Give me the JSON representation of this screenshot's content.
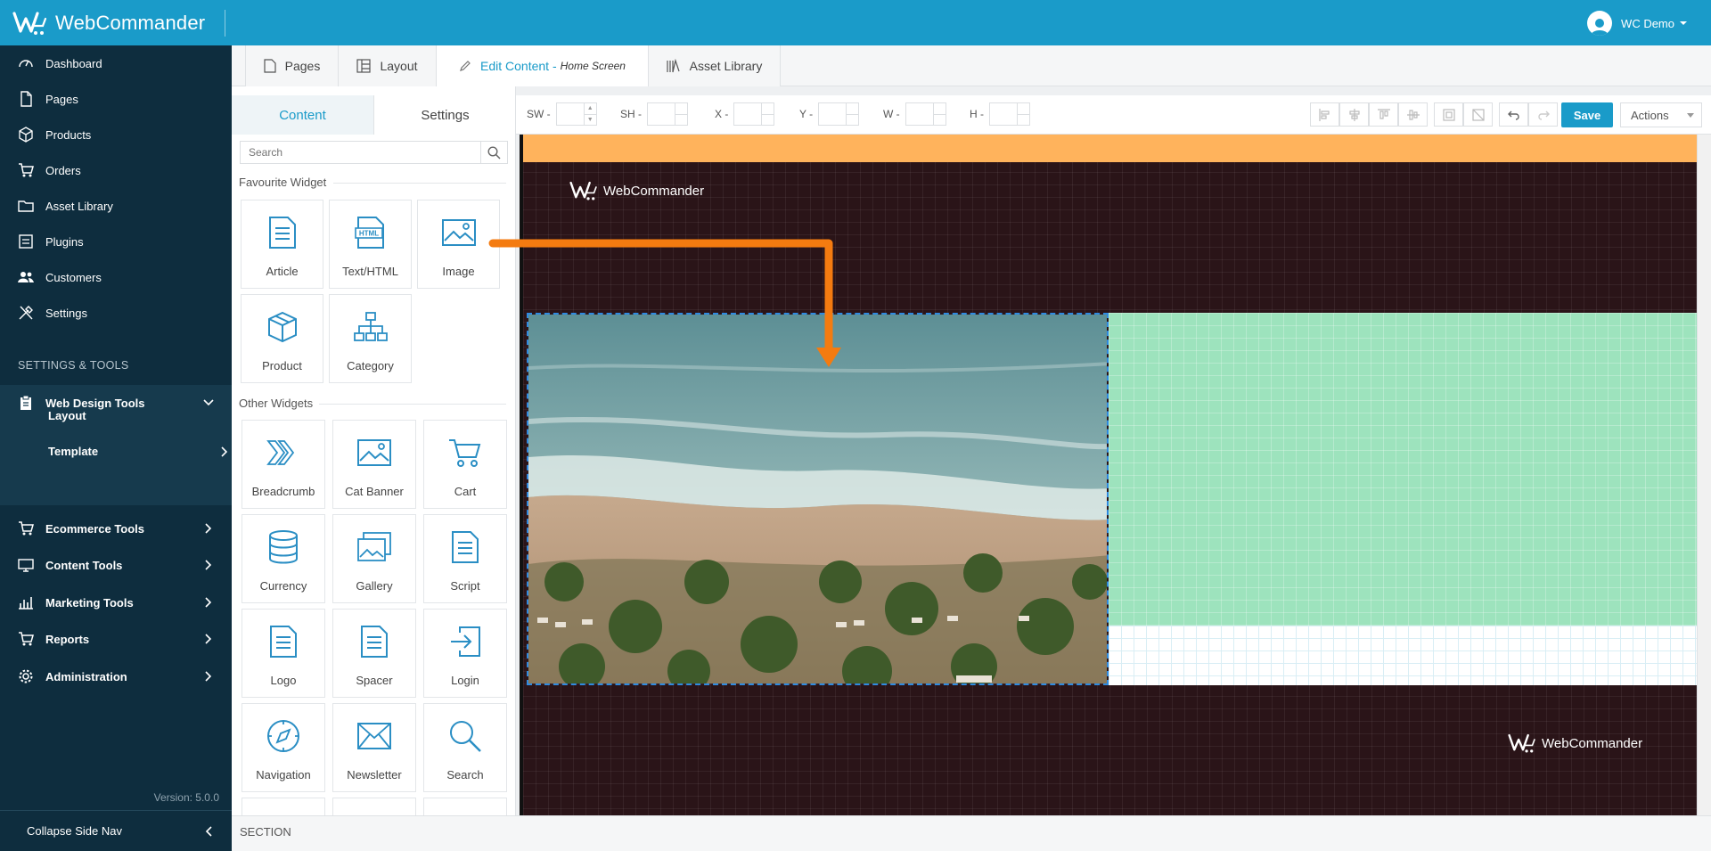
{
  "header": {
    "brand": "WebCommander",
    "user": "WC Demo"
  },
  "sidebar": {
    "items": [
      {
        "label": "Dashboard",
        "icon": "gauge-icon"
      },
      {
        "label": "Pages",
        "icon": "page-icon"
      },
      {
        "label": "Products",
        "icon": "box-icon"
      },
      {
        "label": "Orders",
        "icon": "cart-icon"
      },
      {
        "label": "Asset Library",
        "icon": "folder-icon"
      },
      {
        "label": "Plugins",
        "icon": "plugin-icon"
      },
      {
        "label": "Customers",
        "icon": "users-icon"
      },
      {
        "label": "Settings",
        "icon": "tools-icon"
      }
    ],
    "section_title": "SETTINGS & TOOLS",
    "web_design_tools": "Web Design Tools",
    "sub_layout": "Layout",
    "sub_template": "Template",
    "groups": [
      {
        "label": "Ecommerce Tools"
      },
      {
        "label": "Content Tools"
      },
      {
        "label": "Marketing Tools"
      },
      {
        "label": "Reports"
      },
      {
        "label": "Administration"
      }
    ],
    "version": "Version: 5.0.0",
    "collapse": "Collapse Side Nav"
  },
  "tabs": {
    "pages": "Pages",
    "layout": "Layout",
    "edit_content": "Edit Content -",
    "edit_content_sub": "Home Screen",
    "asset_library": "Asset Library"
  },
  "panel": {
    "tab_content": "Content",
    "tab_settings": "Settings",
    "search_placeholder": "Search",
    "favourite_title": "Favourite Widget",
    "other_title": "Other Widgets",
    "favourites": [
      "Article",
      "Text/HTML",
      "Image",
      "Product",
      "Category"
    ],
    "others": [
      "Breadcrumb",
      "Cat Banner",
      "Cart",
      "Currency",
      "Gallery",
      "Script",
      "Logo",
      "Spacer",
      "Login",
      "Navigation",
      "Newsletter",
      "Search"
    ],
    "html_badge": "HTML"
  },
  "section_bar": {
    "label": "SECTION"
  },
  "toolbar": {
    "sw": "SW -",
    "sh": "SH -",
    "x": "X -",
    "y": "Y -",
    "w": "W -",
    "h": "H -",
    "save": "Save",
    "actions": "Actions"
  },
  "canvas": {
    "logo_text": "WebCommander",
    "colors": {
      "strip": "#ffb35c",
      "background": "#2a1418",
      "green": "#9de3bd",
      "arrow": "#f47b10",
      "accent": "#1a9bc9"
    }
  }
}
